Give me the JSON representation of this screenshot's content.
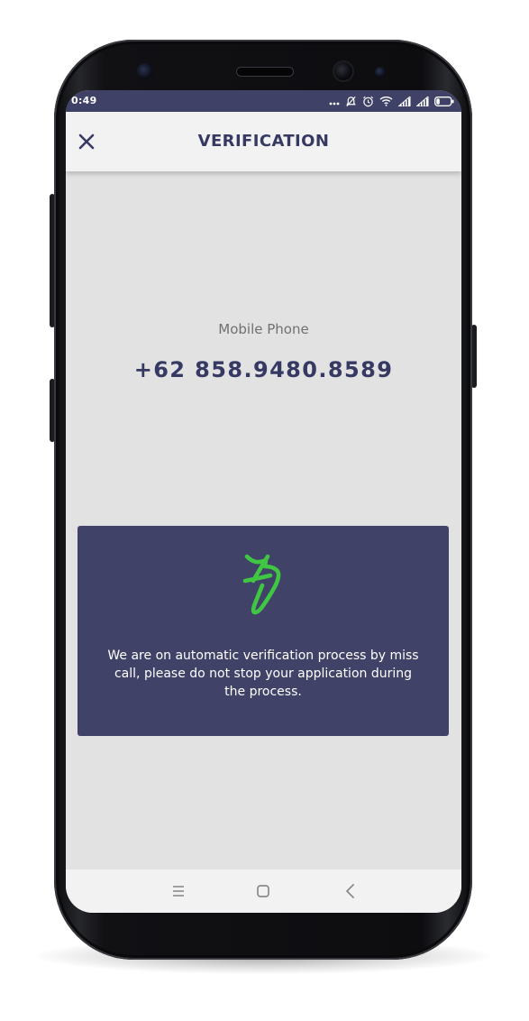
{
  "status_bar": {
    "time": "0:49",
    "icons": [
      "more-dots-icon",
      "notifications-muted-icon",
      "alarm-icon",
      "wifi-icon",
      "signal-icon",
      "signal-icon",
      "battery-icon"
    ]
  },
  "header": {
    "title": "VERIFICATION",
    "close_icon": "close-icon"
  },
  "main": {
    "phone_label": "Mobile Phone",
    "phone_number": "+62 858.9480.8589",
    "info_card": {
      "icon": "bolt-logo-icon",
      "message": "We are on automatic verification process by miss call, please do not stop your application during the process."
    }
  },
  "nav_bar": {
    "items": [
      "recent-apps-icon",
      "home-icon",
      "back-icon"
    ]
  },
  "colors": {
    "status_bar_bg": "#3f4166",
    "header_bg": "#f2f2f2",
    "title_color": "#363a63",
    "content_bg": "#e2e2e2",
    "card_bg": "#404267",
    "accent_green": "#3fc744",
    "label_gray": "#707070"
  }
}
